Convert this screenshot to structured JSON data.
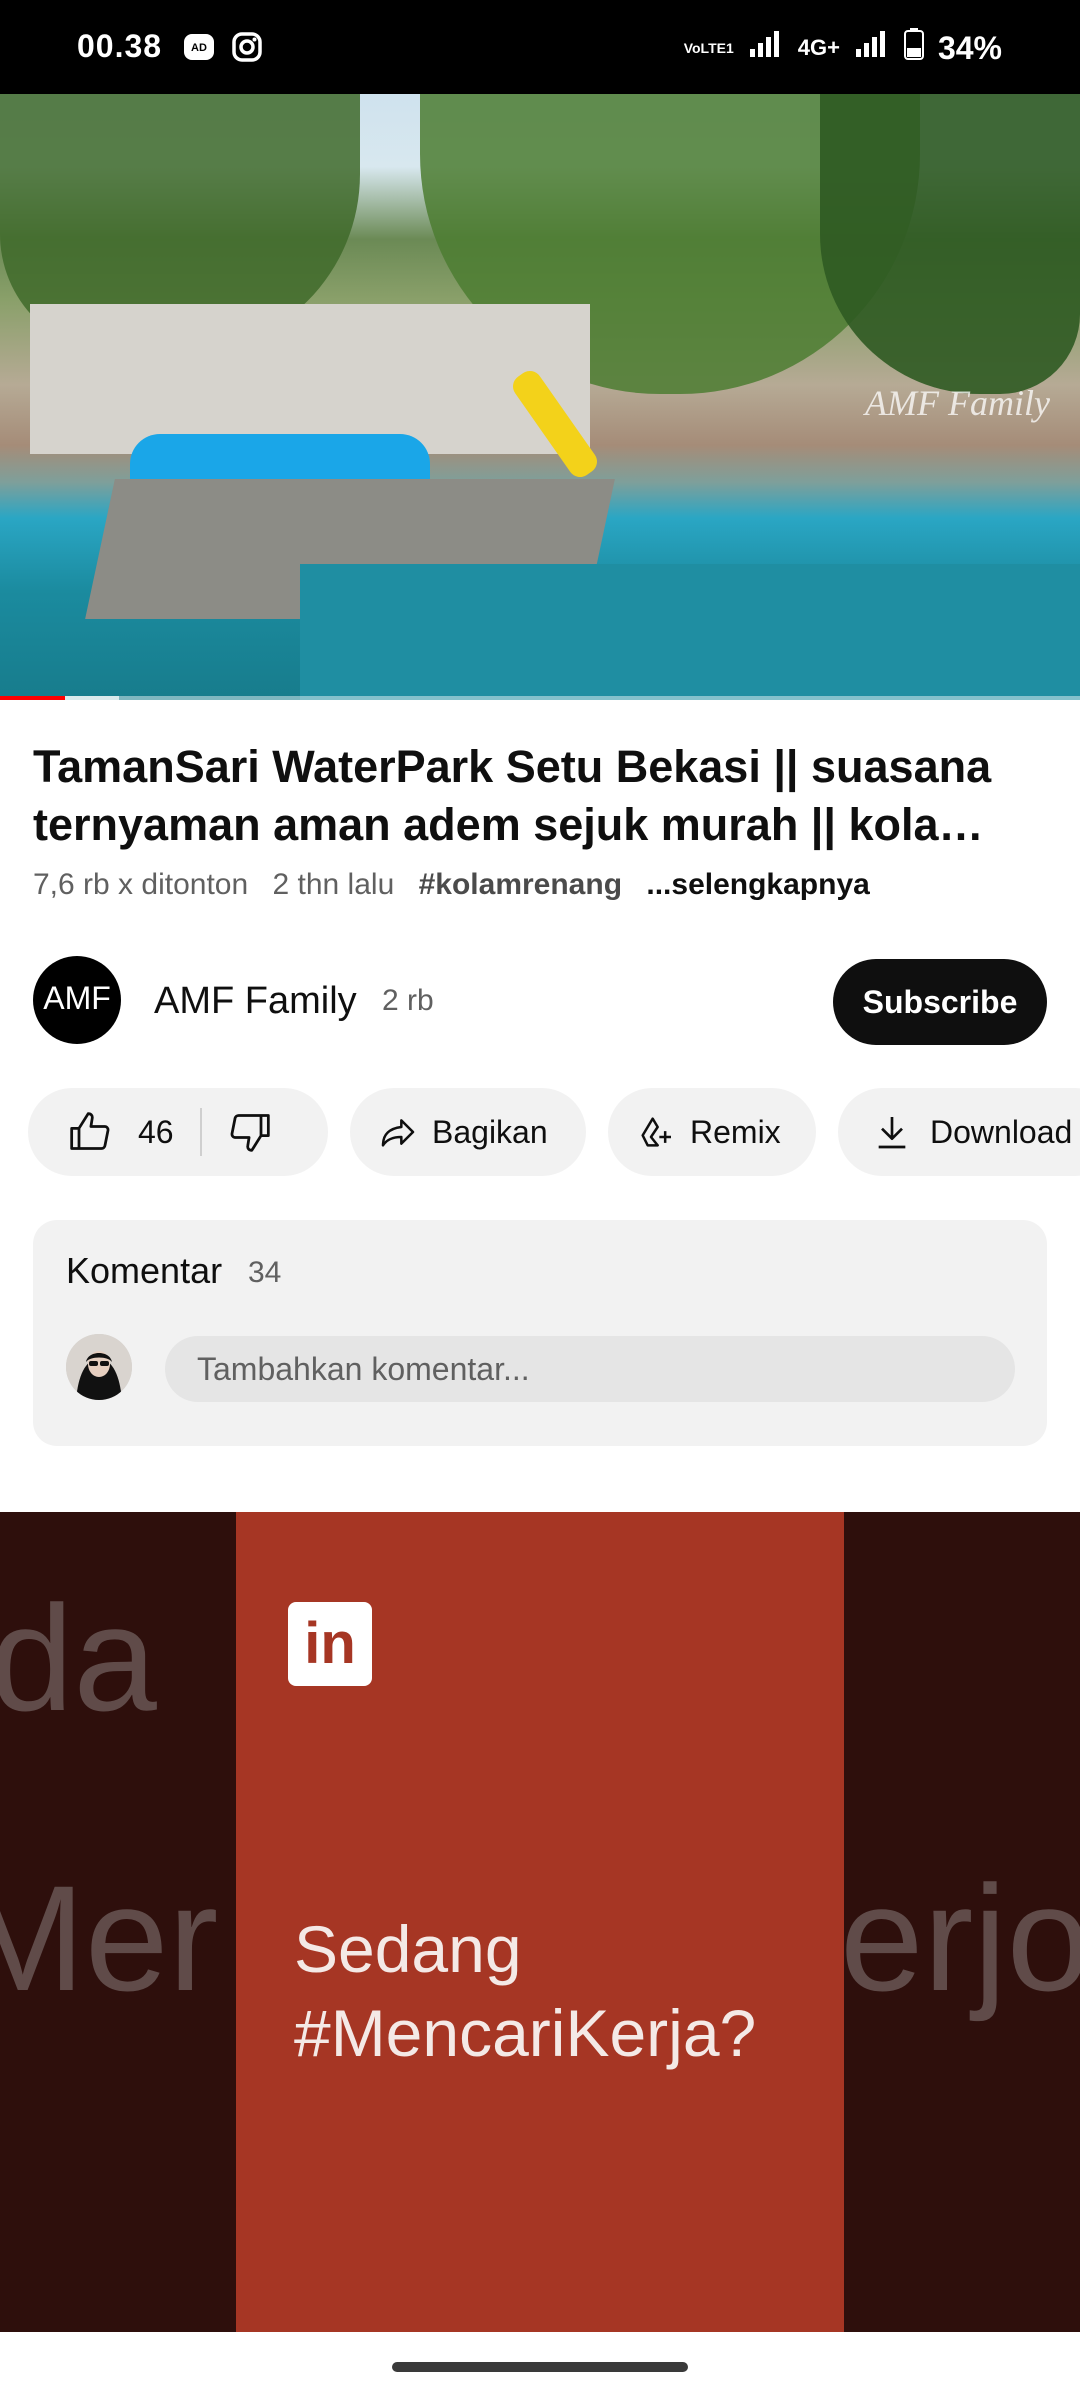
{
  "status_bar": {
    "time": "00.38",
    "left_icons": [
      "ad-blocker-icon",
      "instagram-icon"
    ],
    "network_label": "VoLTE1",
    "network_type": "4G+",
    "battery": "34%"
  },
  "video": {
    "watermark": "AMF Family",
    "progress_fraction": 0.06,
    "buffered_fraction": 0.11
  },
  "details": {
    "title": "TamanSari WaterPark Setu Bekasi || suasana ternyaman aman adem sejuk murah || kola…",
    "views": "7,6 rb x ditonton",
    "age": "2 thn lalu",
    "hashtag": "#kolamrenang",
    "more": "...selengkapnya"
  },
  "channel": {
    "avatar_text": "AMF",
    "name": "AMF Family",
    "subscribers": "2 rb",
    "subscribe_label": "Subscribe"
  },
  "actions": {
    "likes": "46",
    "share_label": "Bagikan",
    "remix_label": "Remix",
    "download_label": "Download"
  },
  "comments": {
    "title": "Komentar",
    "count": "34",
    "placeholder": "Tambahkan komentar..."
  },
  "ad": {
    "logo": "in",
    "line1": "Sedang",
    "line2": "#MencariKerja?",
    "ghost_left_top": "da",
    "ghost_left_bottom": "Mer",
    "ghost_right_bottom": "erjo"
  }
}
